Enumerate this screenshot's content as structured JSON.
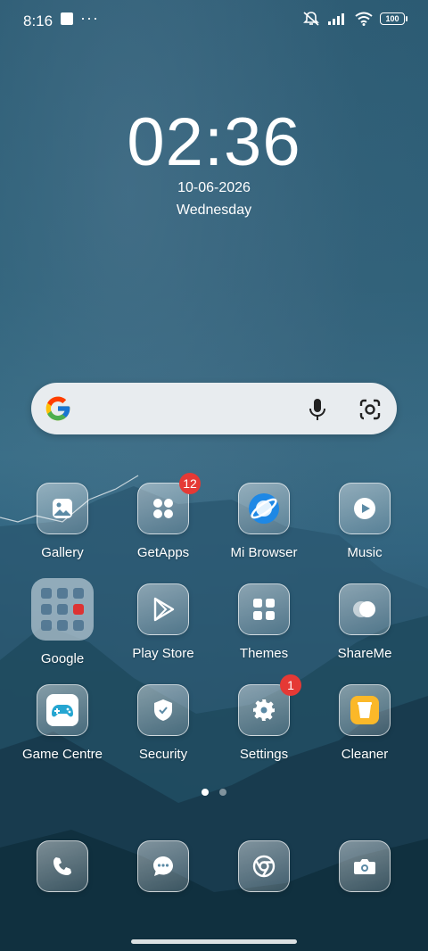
{
  "status_bar": {
    "time": "8:16",
    "battery": "100",
    "icons": [
      "square-notification-icon",
      "more-dots-icon",
      "mute-vibrate-icon",
      "signal-icon",
      "wifi-icon",
      "battery-icon"
    ]
  },
  "clock": {
    "time": "02:36",
    "date": "10-06-2026",
    "day": "Wednesday"
  },
  "search": {
    "icons": [
      "google-g-icon",
      "mic-icon",
      "google-lens-icon"
    ]
  },
  "apps_row1": [
    {
      "label": "Gallery",
      "icon": "gallery-icon"
    },
    {
      "label": "GetApps",
      "icon": "getapps-icon",
      "badge": "12"
    },
    {
      "label": "Mi Browser",
      "icon": "mi-browser-icon"
    },
    {
      "label": "Music",
      "icon": "music-icon"
    }
  ],
  "apps_row2": [
    {
      "label": "Google",
      "icon": "google-folder-icon"
    },
    {
      "label": "Play Store",
      "icon": "play-store-icon"
    },
    {
      "label": "Themes",
      "icon": "themes-icon"
    },
    {
      "label": "ShareMe",
      "icon": "shareme-icon"
    }
  ],
  "apps_row3": [
    {
      "label": "Game Centre",
      "icon": "game-centre-icon"
    },
    {
      "label": "Security",
      "icon": "security-icon"
    },
    {
      "label": "Settings",
      "icon": "settings-icon",
      "badge": "1"
    },
    {
      "label": "Cleaner",
      "icon": "cleaner-icon"
    }
  ],
  "dock": [
    {
      "icon": "phone-icon"
    },
    {
      "icon": "messages-icon"
    },
    {
      "icon": "chrome-icon"
    },
    {
      "icon": "camera-icon"
    }
  ],
  "pager": {
    "pages": 2,
    "current": 1
  }
}
